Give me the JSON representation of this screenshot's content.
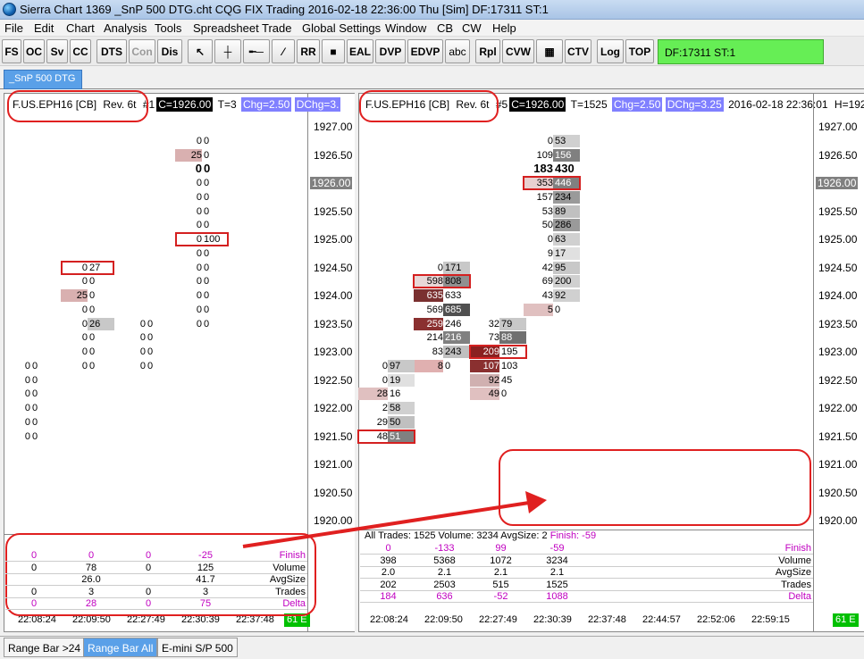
{
  "window": {
    "title": "Sierra Chart 1369 _SnP 500 DTG.cht  CQG FIX Trading 2016-02-18  22:36:00 Thu [Sim]   DF:17311  ST:1"
  },
  "menu": [
    "File",
    "Edit",
    "Chart",
    "Analysis",
    "Tools",
    "Spreadsheet",
    "Trade",
    "Global Settings",
    "Window",
    "CB",
    "CW",
    "Help"
  ],
  "toolbar": {
    "buttons": [
      "FS",
      "OC",
      "Sv",
      "CC",
      "DTS",
      "Con",
      "Dis",
      "RR",
      "EAL",
      "DVP",
      "EDVP",
      "abc",
      "Rpl",
      "CVW",
      "CTV",
      "Log",
      "TOP"
    ],
    "status": "DF:17311  ST:1"
  },
  "chartbook_tab": "_SnP 500 DTG",
  "price_axis": [
    "1927.00",
    "1926.50",
    "1926.00",
    "1925.50",
    "1925.00",
    "1924.50",
    "1924.00",
    "1923.50",
    "1923.00",
    "1922.50",
    "1922.00",
    "1921.50",
    "1921.00",
    "1920.50",
    "1920.00"
  ],
  "left": {
    "header": {
      "symbol": "F.US.EPH16 [CB]",
      "rev": "Rev. 6t",
      "num": "#1",
      "close": "C=1926.00",
      "trades": "T=3",
      "chg": "Chg=2.50",
      "dchg": "DChg=3."
    },
    "cells": [
      [
        "0 0",
        "",
        "",
        ""
      ],
      [
        "25",
        "0"
      ],
      [
        "0",
        "0"
      ]
    ],
    "summary": {
      "rows": [
        {
          "label": "Finish",
          "vals": [
            "0",
            "0",
            "0",
            "-25"
          ]
        },
        {
          "label": "Volume",
          "vals": [
            "0",
            "78",
            "0",
            "125"
          ]
        },
        {
          "label": "AvgSize",
          "vals": [
            "",
            "26.0",
            "",
            "41.7"
          ]
        },
        {
          "label": "Trades",
          "vals": [
            "0",
            "3",
            "0",
            "3"
          ]
        },
        {
          "label": "Delta",
          "vals": [
            "0",
            "28",
            "0",
            "75"
          ]
        }
      ]
    },
    "times": [
      "22:08:24",
      "22:09:50",
      "22:27:49",
      "22:30:39",
      "22:37:48"
    ],
    "badge": "61 E"
  },
  "right": {
    "header": {
      "symbol": "F.US.EPH16 [CB]",
      "rev": "Rev. 6t",
      "num": "#5",
      "close": "C=1926.00",
      "trades": "T=1525",
      "chg": "Chg=2.50",
      "dchg": "DChg=3.25",
      "datetime": "2016-02-18  22:36:01",
      "high": "H=192"
    },
    "summary_title": {
      "text": "All  Trades: 1525  Volume: 3234  AvgSize: 2",
      "finish": "Finish: -59"
    },
    "summary": {
      "rows": [
        {
          "label": "Finish",
          "vals": [
            "0",
            "-133",
            "99",
            "-59"
          ]
        },
        {
          "label": "Volume",
          "vals": [
            "398",
            "5368",
            "1072",
            "3234"
          ]
        },
        {
          "label": "AvgSize",
          "vals": [
            "2.0",
            "2.1",
            "2.1",
            "2.1"
          ]
        },
        {
          "label": "Trades",
          "vals": [
            "202",
            "2503",
            "515",
            "1525"
          ]
        },
        {
          "label": "Delta",
          "vals": [
            "184",
            "636",
            "-52",
            "1088"
          ]
        }
      ]
    },
    "times": [
      "22:08:24",
      "22:09:50",
      "22:27:49",
      "22:30:39",
      "22:37:48",
      "22:44:57",
      "22:52:06",
      "22:59:15"
    ],
    "badge": "61 E"
  },
  "bottom_tabs": [
    "Range Bar >24",
    "Range Bar All",
    "E-mini S/P 500"
  ],
  "colors": {
    "accent": "#5aa0e8",
    "annotation": "#e02020",
    "status_green": "#66ee55"
  }
}
